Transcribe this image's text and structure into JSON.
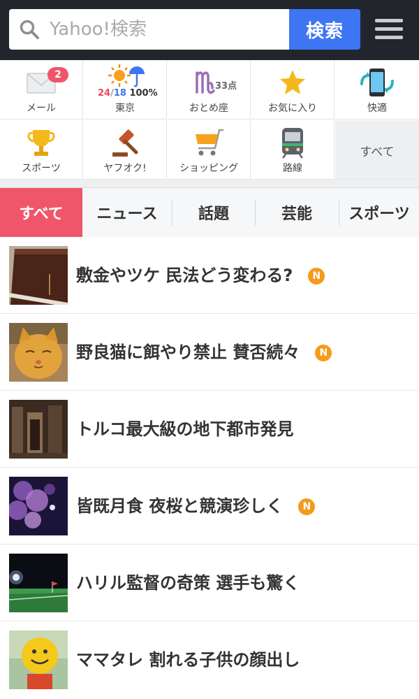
{
  "header": {
    "search_placeholder": "Yahoo!検索",
    "search_button": "検索"
  },
  "services": [
    {
      "label": "メール",
      "icon": "mail-icon",
      "badge": "2"
    },
    {
      "label": "東京",
      "icon": "weather-icon",
      "temp_high": "24",
      "temp_low": "18",
      "rain_chance": "100%"
    },
    {
      "label": "おとめ座",
      "icon": "virgo-icon",
      "points": "33点"
    },
    {
      "label": "お気に入り",
      "icon": "star-icon"
    },
    {
      "label": "快適",
      "icon": "phone-icon"
    },
    {
      "label": "スポーツ",
      "icon": "trophy-icon"
    },
    {
      "label": "ヤフオク!",
      "icon": "gavel-icon"
    },
    {
      "label": "ショッピング",
      "icon": "cart-icon"
    },
    {
      "label": "路線",
      "icon": "train-icon"
    },
    {
      "label": "すべて",
      "icon": ""
    }
  ],
  "tabs": [
    "すべて",
    "ニュース",
    "話題",
    "芸能",
    "スポーツ"
  ],
  "news": [
    {
      "title": "敷金やツケ 民法どう変わる?",
      "new": true,
      "badge": "N",
      "thumb": "book-photo"
    },
    {
      "title": "野良猫に餌やり禁止 賛否続々",
      "new": true,
      "badge": "N",
      "thumb": "cat-photo"
    },
    {
      "title": "トルコ最大級の地下都市発見",
      "new": false,
      "thumb": "cave-photo"
    },
    {
      "title": "皆既月食 夜桜と競演珍しく",
      "new": true,
      "badge": "N",
      "thumb": "sakura-photo"
    },
    {
      "title": "ハリル監督の奇策 選手も驚く",
      "new": false,
      "thumb": "stadium-photo"
    },
    {
      "title": "ママタレ 割れる子供の顔出し",
      "new": false,
      "thumb": "child-photo"
    }
  ],
  "colors": {
    "header_bg": "#22262c",
    "search_button": "#3d75f2",
    "accent": "#f0566a",
    "new_badge": "#f59a1a"
  }
}
